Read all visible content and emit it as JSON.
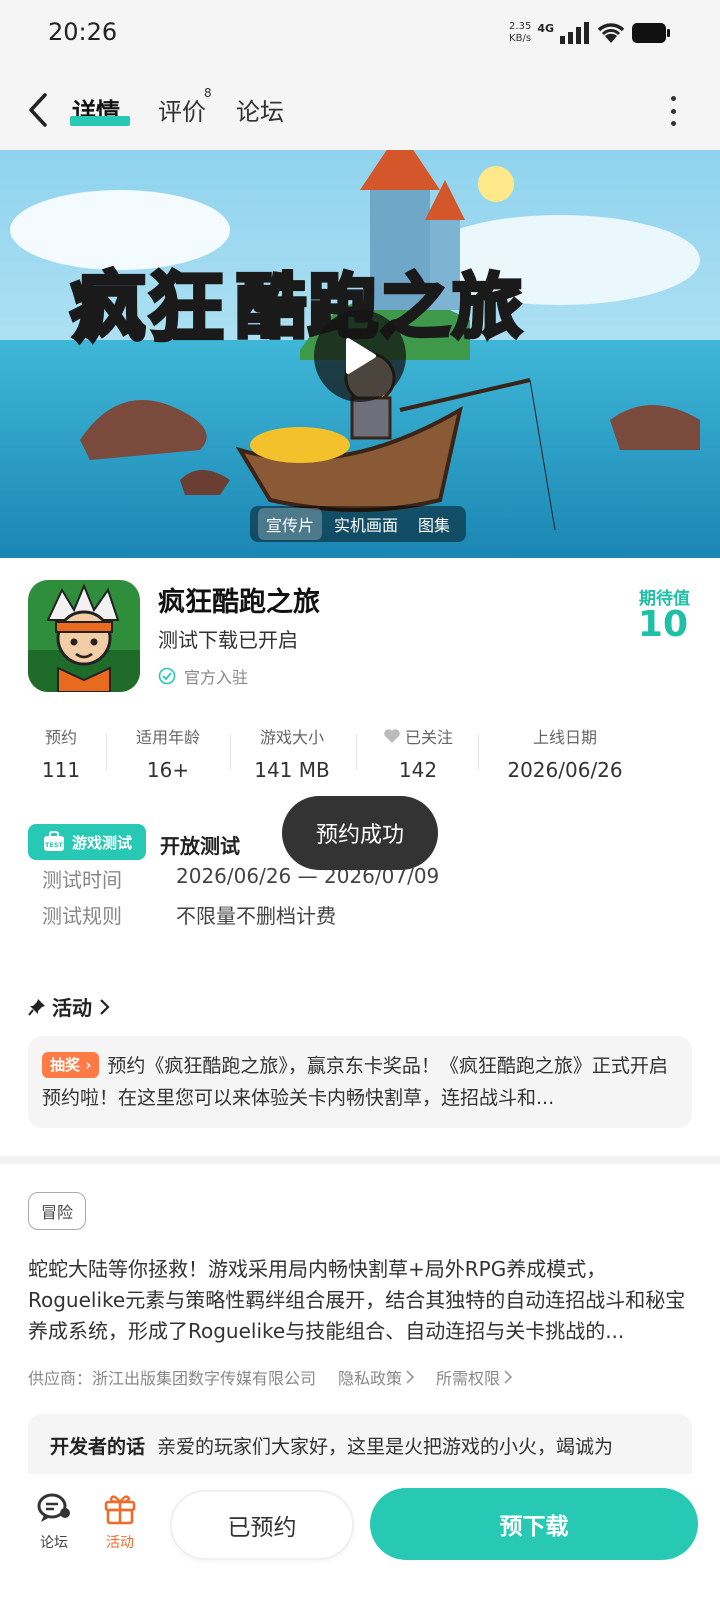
{
  "status": {
    "time": "20:26",
    "net_speed": "2.35",
    "net_unit": "KB/s",
    "net_type": "4G"
  },
  "nav": {
    "tabs": [
      {
        "label": "详情"
      },
      {
        "label": "评价",
        "badge": "8"
      },
      {
        "label": "论坛"
      }
    ]
  },
  "banner": {
    "title_yellow": "疯狂",
    "title_white": "酷跑之旅",
    "media_tabs": [
      "宣传片",
      "实机画面",
      "图集"
    ]
  },
  "game": {
    "name": "疯狂酷跑之旅",
    "status": "测试下载已开启",
    "official": "官方入驻",
    "expect_label": "期待值",
    "expect_value": "10"
  },
  "stats": [
    {
      "label": "预约",
      "value": "111"
    },
    {
      "label": "适用年龄",
      "value": "16+"
    },
    {
      "label": "游戏大小",
      "value": "141 MB"
    },
    {
      "label": "已关注",
      "value": "142"
    },
    {
      "label": "上线日期",
      "value": "2026/06/26"
    }
  ],
  "test": {
    "badge": "游戏测试",
    "badge_icon_text": "TEST",
    "type": "开放测试",
    "time_label": "测试时间",
    "time_value": "2026/06/26 — 2026/07/09",
    "rule_label": "测试规则",
    "rule_value": "不限量不删档计费"
  },
  "toast": "预约成功",
  "activity": {
    "header": "活动",
    "tag": "抽奖",
    "text": "预约《疯狂酷跑之旅》，赢京东卡奖品！《疯狂酷跑之旅》正式开启预约啦！在这里您可以来体验关卡内畅快割草，连招战斗和..."
  },
  "detail": {
    "genre": "冒险",
    "description": "蛇蛇大陆等你拯救！游戏采用局内畅快割草+局外RPG养成模式，Roguelike元素与策略性羁绊组合展开，结合其独特的自动连招战斗和秘宝养成系统，形成了Roguelike与技能组合、自动连招与关卡挑战的...",
    "supplier": "供应商：浙江出版集团数字传媒有限公司",
    "privacy": "隐私政策",
    "permissions": "所需权限"
  },
  "dev": {
    "label": "开发者的话",
    "text": "亲爱的玩家们大家好，这里是火把游戏的小火，竭诚为"
  },
  "bottom": {
    "forum": "论坛",
    "activity": "活动",
    "reserved": "已预约",
    "download": "预下载"
  },
  "colors": {
    "accent": "#27c9b4",
    "orange": "#ff7a45",
    "toast": "#333333"
  }
}
